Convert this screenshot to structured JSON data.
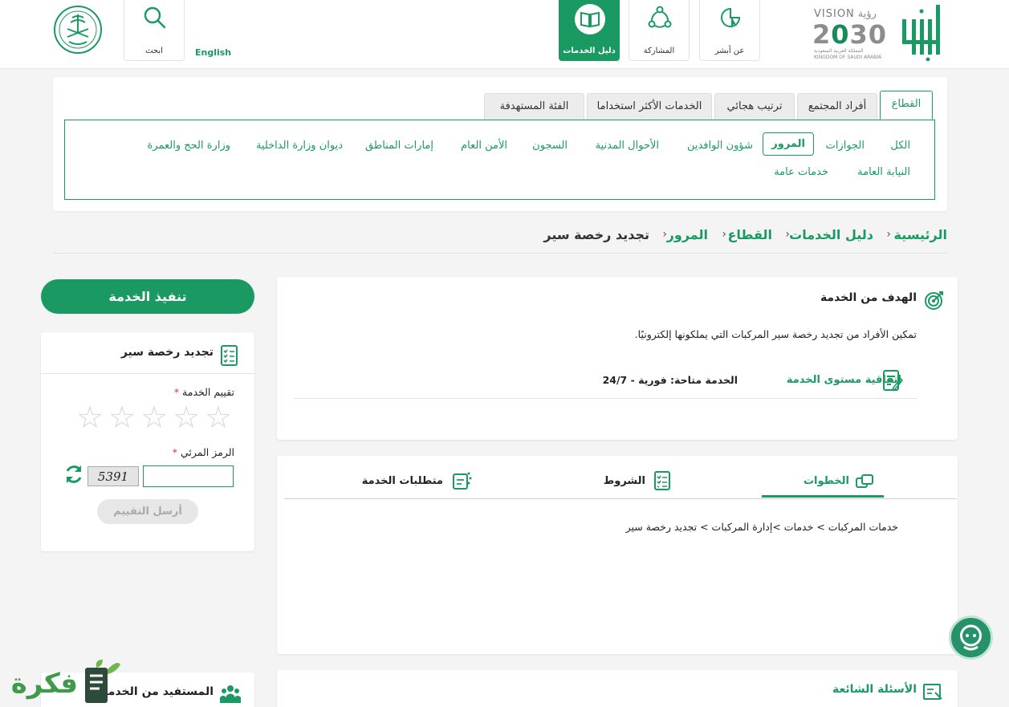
{
  "header": {
    "nav": [
      {
        "id": "about",
        "label": "عن أبشر",
        "icon": "pie-pointer-icon"
      },
      {
        "id": "participation",
        "label": "المشاركة",
        "icon": "network-icon"
      },
      {
        "id": "services-guide",
        "label": "دليل الخدمات",
        "icon": "book-icon"
      }
    ],
    "search_label": "ابحث",
    "language_link": "English",
    "vision": {
      "title_en": "VISION",
      "title_ar": "رؤية",
      "year_a": "2",
      "year_zero": "0",
      "year_b": "30",
      "line_ar": "المملكة العربية السعودية",
      "line_en": "KINGDOM OF SAUDI ARABIA"
    },
    "colors": {
      "brand": "#1a9a62",
      "header_bg": "#ffffff"
    }
  },
  "filter": {
    "tabs": [
      {
        "label": "القطاع",
        "active": true
      },
      {
        "label": "أفراد المجتمع",
        "active": false
      },
      {
        "label": "ترتيب هجائي",
        "active": false
      },
      {
        "label": "الخدمات الأكثر استخداما",
        "active": false
      },
      {
        "label": "الفئة المستهدفة",
        "active": false
      }
    ],
    "sectors_row1": [
      "الكل",
      "الجوازات",
      "المرور",
      "شؤون الوافدين",
      "الأحوال المدنية",
      "السجون",
      "الأمن العام",
      "إمارات المناطق",
      "ديوان وزارة الداخلية",
      "وزارة الحج والعمرة"
    ],
    "sectors_row2": [
      "النيابة العامة",
      "خدمات عامة"
    ],
    "active_sector": "المرور"
  },
  "breadcrumb": {
    "items": [
      "الرئيسية",
      "دليل الخدمات",
      "القطاع",
      "المرور"
    ],
    "current": "تجديد رخصة سير",
    "separator": "‹"
  },
  "service": {
    "goal_title": "الهدف من الخدمة",
    "goal_text": "تمكين الأفراد من تجديد رخصة سير المركبات التي يملكونها إلكترونيًا.",
    "sla_link": "اتفاقية مستوى الخدمة",
    "availability": "الخدمة متاحة: فورية - 24/7",
    "tabs": [
      {
        "label": "الخطوات",
        "active": true
      },
      {
        "label": "الشروط",
        "active": false
      },
      {
        "label": "متطلبات الخدمة",
        "active": false
      }
    ],
    "steps_path": "خدمات المركبات > خدمات >إدارة المركبات > تجديد رخصة سير",
    "faq_title": "الأسئلة الشائعة"
  },
  "sidebar": {
    "execute_button": "تنفيذ الخدمة",
    "card_title": "تجديد رخصة سير",
    "rating_label": "تقييم الخدمة",
    "required_mark": "*",
    "stars_total": 5,
    "rating_value": 0,
    "captcha_label": "الرمز المرئي",
    "captcha_code": "5391",
    "captcha_value": "",
    "submit_button": "أرسل التقييم",
    "beneficiary_title": "المستفيد من الخدمة"
  },
  "watermark": {
    "text": "فكرة"
  }
}
